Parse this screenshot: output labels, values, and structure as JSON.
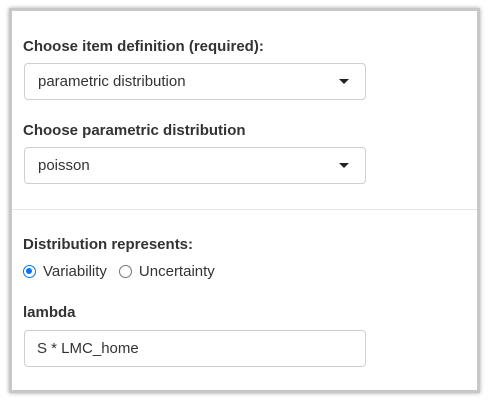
{
  "item_definition": {
    "label": "Choose item definition (required):",
    "selected": "parametric distribution"
  },
  "parametric_distribution": {
    "label": "Choose parametric distribution",
    "selected": "poisson"
  },
  "distribution_represents": {
    "label": "Distribution represents:",
    "options": [
      {
        "label": "Variability",
        "checked": true
      },
      {
        "label": "Uncertainty",
        "checked": false
      }
    ]
  },
  "lambda": {
    "label": "lambda",
    "value": "S * LMC_home"
  },
  "icons": {
    "select_caret": "caret-down-icon",
    "radio_checked": "radio-checked-icon",
    "radio_unchecked": "radio-unchecked-icon"
  },
  "colors": {
    "accent": "#0075ff",
    "text": "#333333",
    "border": "#cfcfcf"
  }
}
